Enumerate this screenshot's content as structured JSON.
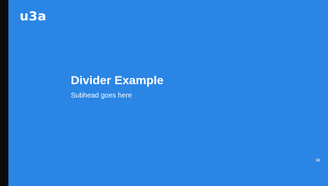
{
  "slide": {
    "logo_text": "u3a",
    "title": "Divider Example",
    "subhead": "Subhead goes here",
    "page_number": "14"
  },
  "colors": {
    "background": "#2a85e4",
    "frame": "#0b0b0b",
    "text": "#ffffff"
  }
}
